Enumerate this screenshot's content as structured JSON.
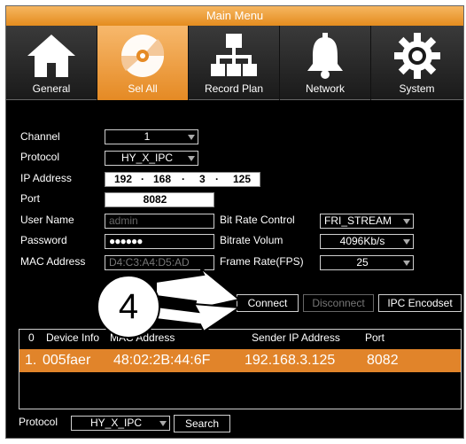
{
  "window": {
    "title": "Main Menu"
  },
  "tabs": [
    {
      "label": "General",
      "icon": "home-icon",
      "active": false
    },
    {
      "label": "Sel All",
      "icon": "disc-icon",
      "active": true
    },
    {
      "label": "Record Plan",
      "icon": "network-tree-icon",
      "active": false
    },
    {
      "label": "Network",
      "icon": "bell-icon",
      "active": false
    },
    {
      "label": "System",
      "icon": "gear-icon",
      "active": false
    }
  ],
  "form": {
    "channel": {
      "label": "Channel",
      "value": "1"
    },
    "protocol": {
      "label": "Protocol",
      "value": "HY_X_IPC"
    },
    "ip": {
      "label": "IP Address",
      "octets": [
        "192",
        "168",
        "3",
        "125"
      ]
    },
    "port": {
      "label": "Port",
      "value": "8082"
    },
    "username": {
      "label": "User Name",
      "placeholder": "admin"
    },
    "password": {
      "label": "Password",
      "value": "●●●●●●"
    },
    "mac": {
      "label": "MAC Address",
      "value": "D4:C3:A4:D5:AD"
    },
    "bitrate_control": {
      "label": "Bit Rate Control",
      "value": "FRI_STREAM"
    },
    "bitrate_volume": {
      "label": "Bitrate Volum",
      "value": "4096Kb/s"
    },
    "frame_rate": {
      "label": "Frame Rate(FPS)",
      "value": "25"
    }
  },
  "buttons": {
    "connect": "Connect",
    "disconnect": "Disconnect",
    "ipc_encodset": "IPC Encodset",
    "search": "Search"
  },
  "table": {
    "headers": [
      "0",
      "Device Info",
      "MAC Address",
      "Sender IP Address",
      "Port"
    ],
    "rows": [
      {
        "index": "1.",
        "device": "005faer",
        "mac": "48:02:2B:44:6F",
        "ip": "192.168.3.125",
        "port": "8082"
      }
    ]
  },
  "bottom": {
    "protocol_label": "Protocol",
    "protocol_value": "HY_X_IPC"
  },
  "annotation": {
    "step": "4"
  },
  "colors": {
    "accent": "#e58a24",
    "background": "#000000",
    "text": "#ffffff"
  }
}
